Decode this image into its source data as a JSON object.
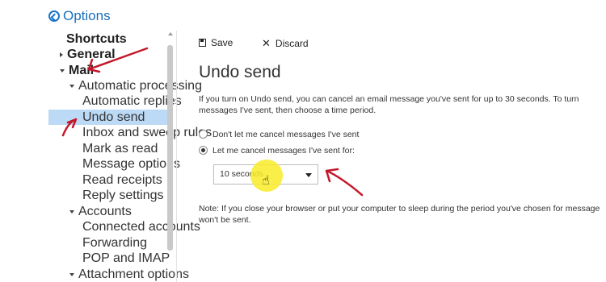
{
  "header": {
    "title": "Options"
  },
  "nav": {
    "shortcuts": "Shortcuts",
    "general": "General",
    "mail": "Mail",
    "automatic_processing": "Automatic processing",
    "automatic_replies": "Automatic replies",
    "undo_send": "Undo send",
    "inbox_sweep": "Inbox and sweep rules",
    "mark_as_read": "Mark as read",
    "message_options": "Message options",
    "read_receipts": "Read receipts",
    "reply_settings": "Reply settings",
    "accounts": "Accounts",
    "connected_accounts": "Connected accounts",
    "forwarding": "Forwarding",
    "pop_imap": "POP and IMAP",
    "attachment_options": "Attachment options"
  },
  "toolbar": {
    "save_label": "Save",
    "discard_label": "Discard"
  },
  "main": {
    "title": "Undo send",
    "description": "If you turn on Undo send, you can cancel an email message you've sent for up to 30 seconds. To turn messages I've sent, then choose a time period.",
    "option_off": "Don't let me cancel messages I've sent",
    "option_on": "Let me cancel messages I've sent for:",
    "selected_option": "option_on",
    "select_value": "10 seconds",
    "note": "Note: If you close your browser or put your computer to sleep during the period you've chosen for message won't be sent."
  },
  "colors": {
    "accent": "#1a6fc0",
    "selected_bg": "#bcd9f5",
    "annotation": "#c4182a",
    "highlight": "#f8ec28"
  },
  "icons": [
    "back-icon",
    "save-icon",
    "close-icon",
    "chevron-down-icon",
    "hand-cursor-icon"
  ]
}
